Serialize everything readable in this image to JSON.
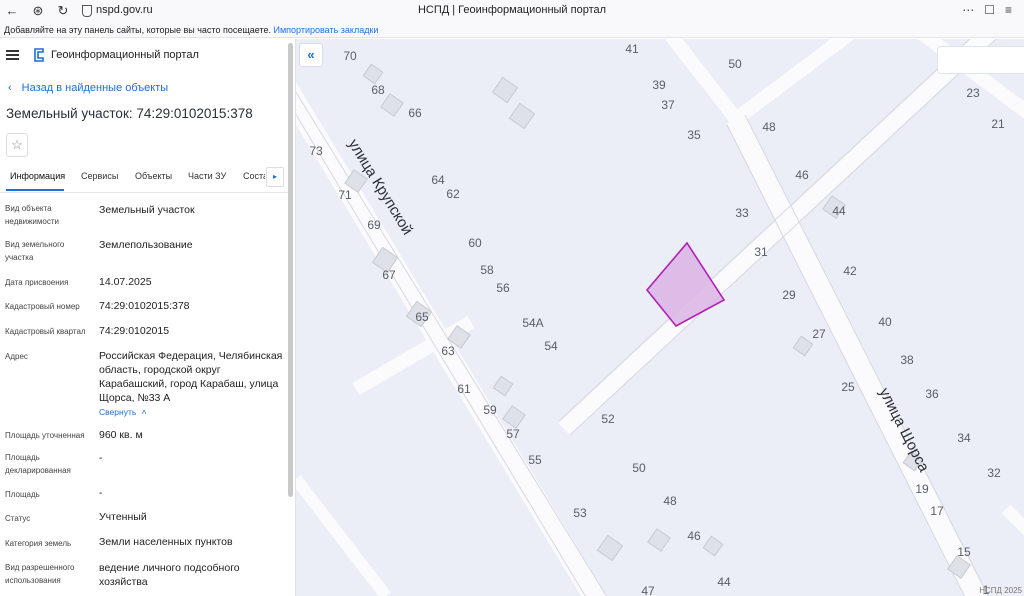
{
  "browser": {
    "url": "nspd.gov.ru",
    "window_title": "НСПД | Геоинформационный портал",
    "bookmarks_text": "Добавляйте на эту панель сайты, которые вы часто посещаете.",
    "bookmarks_link": "Импортировать закладки"
  },
  "sidebar": {
    "portal_name": "Геоинформационный портал",
    "back_label": "Назад в найденные объекты",
    "title": "Земельный участок: 74:29:0102015:378",
    "tabs": [
      "Информация",
      "Сервисы",
      "Объекты",
      "Части ЗУ",
      "Соста"
    ],
    "fields": [
      {
        "label": "Вид объекта недвижимости",
        "value": "Земельный участок"
      },
      {
        "label": "Вид земельного участка",
        "value": "Землепользование"
      },
      {
        "label": "Дата присвоения",
        "value": "14.07.2025"
      },
      {
        "label": "Кадастровый номер",
        "value": "74:29:0102015:378"
      },
      {
        "label": "Кадастровый квартал",
        "value": "74:29:0102015"
      },
      {
        "label": "Адрес",
        "value": "Российская Федерация, Челябинская область, городской округ Карабашский, город Карабаш, улица Щорса, №33 А"
      },
      {
        "label": "Площадь уточненная",
        "value": "960 кв. м"
      },
      {
        "label": "Площадь декларированная",
        "value": "-"
      },
      {
        "label": "Площадь",
        "value": "-"
      },
      {
        "label": "Статус",
        "value": "Учтенный"
      },
      {
        "label": "Категория земель",
        "value": "Земли населенных пунктов"
      },
      {
        "label": "Вид разрешенного использования",
        "value": "ведение личного подсобного хозяйства"
      }
    ],
    "collapse_label": "Свернуть"
  },
  "map": {
    "streets": [
      "улица Крупской",
      "улица Щорса"
    ],
    "house_numbers": [
      "70",
      "68",
      "66",
      "41",
      "39",
      "37",
      "35",
      "50",
      "48",
      "46",
      "44",
      "42",
      "40",
      "38",
      "36",
      "34",
      "32",
      "73",
      "71",
      "69",
      "67",
      "65",
      "64",
      "62",
      "60",
      "58",
      "56",
      "54А",
      "54",
      "63",
      "61",
      "59",
      "57",
      "55",
      "53",
      "52",
      "50",
      "48",
      "46",
      "44",
      "47",
      "33",
      "31",
      "29",
      "27",
      "25",
      "23",
      "21",
      "19",
      "17",
      "15",
      "1"
    ],
    "attribution": "НСПД 2025",
    "parcel_color": "#b01fb6"
  }
}
